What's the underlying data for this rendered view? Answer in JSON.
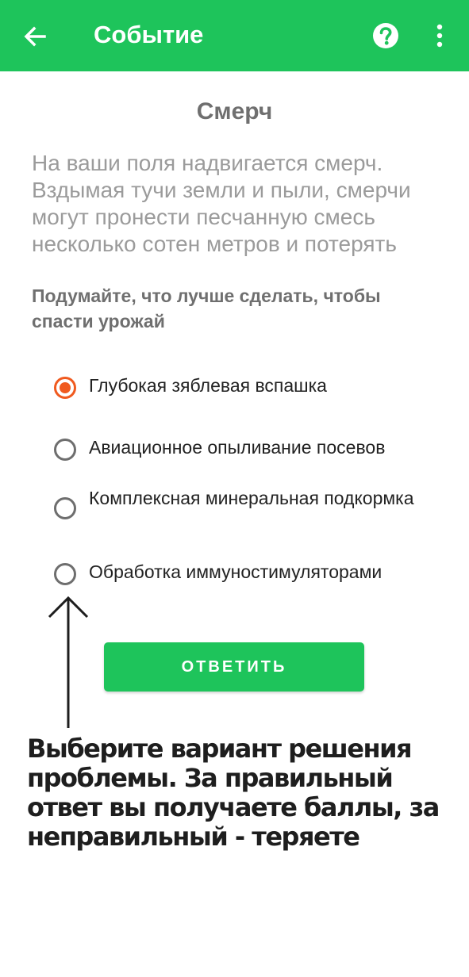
{
  "appbar": {
    "title": "Событие",
    "color": "#1ec45b",
    "icons": [
      "arrow-left-icon",
      "help-circle-icon",
      "more-vertical-icon"
    ]
  },
  "event": {
    "title": "Смерч",
    "description": "На ваши поля надвигается смерч. Вздымая тучи земли и пыли, смерчи могут пронести песчанную смесь несколько сотен метров и потерять",
    "prompt": "Подумайте, что лучше сделать, чтобы спасти урожай"
  },
  "options": [
    {
      "label": "Глубокая зяблевая вспашка",
      "selected": true
    },
    {
      "label": "Авиационное опыливание посевов",
      "selected": false
    },
    {
      "label": "Комплексная минеральная подкормка",
      "selected": false
    },
    {
      "label": "Обработка иммуностимуляторами",
      "selected": false
    }
  ],
  "submit": {
    "label": "ОТВЕТИТЬ"
  },
  "hint": {
    "text": "Выберите вариант решения проблемы. За правильный ответ вы получаете баллы, за неправильный - теряете"
  },
  "colors": {
    "accent": "#1ec45b",
    "radio_selected": "#f05a1f"
  }
}
